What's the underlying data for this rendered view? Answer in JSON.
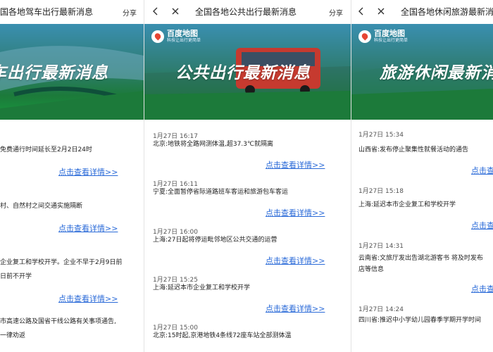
{
  "panels": [
    {
      "title": "国各地驾车出行最新消息",
      "share": "分享",
      "banner_text": "车出行最新消息",
      "items": [
        {
          "time": "",
          "lines": [
            "免费通行时间延长至2月2日24时"
          ],
          "more": "点击查看详情>>"
        },
        {
          "time": "",
          "lines": [
            "村、自然村之间交通实施隔断"
          ],
          "more": "点击查看详情>>"
        },
        {
          "time": "",
          "lines": [
            "企业复工和学校开学。企业不早于2月9日前",
            "日前不开学"
          ],
          "more": "点击查看详情>>"
        },
        {
          "time": "",
          "lines": [
            "市高速公路及国省干线公路有关事项通告,",
            "一律劝返"
          ],
          "more": ""
        }
      ]
    },
    {
      "title": "全国各地公共出行最新消息",
      "share": "分享",
      "brand": "百度地图",
      "slogan": "科技让出行更简单",
      "banner_text": "公共出行最新消息",
      "items": [
        {
          "time": "1月27日 16:17",
          "lines": [
            "北京:地铁将全路网测体温,超37.3℃就隔离"
          ],
          "more": "点击查看详情>>"
        },
        {
          "time": "1月27日 16:11",
          "lines": [
            "宁夏:全面暂停省际道路班车客运和旅游包车客运"
          ],
          "more": "点击查看详情>>"
        },
        {
          "time": "1月27日 16:00",
          "lines": [
            "上海:27日起将停运毗邻地区公共交通的运营"
          ],
          "more": "点击查看详情>>"
        },
        {
          "time": "1月27日 15:25",
          "lines": [
            "上海:延迟本市企业复工和学校开学"
          ],
          "more": "点击查看详情>>"
        },
        {
          "time": "1月27日 15:00",
          "lines": [
            "北京:15时起,京港地铁4条线72座车站全部测体温"
          ],
          "more": ""
        }
      ]
    },
    {
      "title": "全国各地休闲旅游最新消息",
      "brand": "百度地图",
      "slogan": "科技让出行更简单",
      "banner_text": "旅游休闲最新消息",
      "items": [
        {
          "time": "1月27日 15:34",
          "lines": [
            "山西省:发布停止聚集性就餐活动的通告"
          ],
          "more": "点击查看详情>>"
        },
        {
          "time": "1月27日 15:18",
          "lines": [
            "上海:延迟本市企业复工和学校开学"
          ],
          "more": "点击查看详情>>"
        },
        {
          "time": "1月27日 14:31",
          "lines": [
            "云南省:文旅厅发出告湖北游客书 将及时发布",
            "店等信息"
          ],
          "more": "点击查看详情>>"
        },
        {
          "time": "1月27日 14:24",
          "lines": [
            "四川省:推迟中小学幼儿园春季学期开学时间"
          ],
          "more": ""
        }
      ]
    }
  ],
  "colors": {
    "link": "#2a6ad8",
    "banner_green": "#179a3f",
    "logo_red": "#e64533"
  },
  "icons": {
    "back": "chevron-left-icon",
    "close": "close-icon"
  }
}
